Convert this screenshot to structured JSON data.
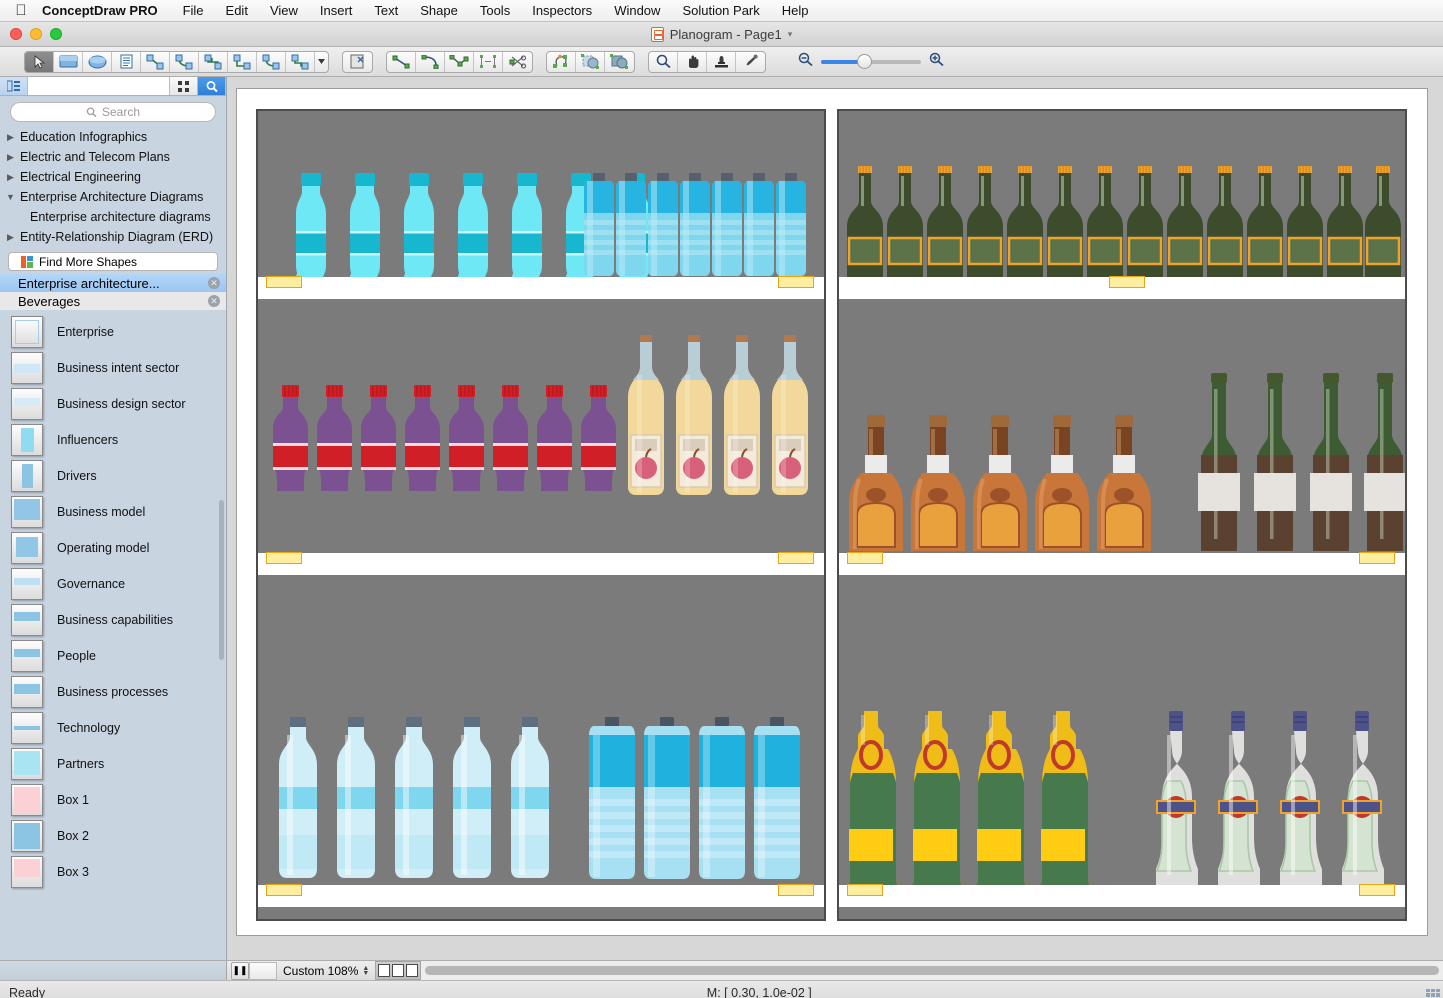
{
  "menubar": {
    "apple_icon": "apple-logo",
    "app_name": "ConceptDraw PRO",
    "items": [
      "File",
      "Edit",
      "View",
      "Insert",
      "Text",
      "Shape",
      "Tools",
      "Inspectors",
      "Window",
      "Solution Park",
      "Help"
    ]
  },
  "titlebar": {
    "document_title": "Planogram - Page1",
    "chevron": "⌄"
  },
  "toolbar": {
    "groups": [
      {
        "name": "selection-tools",
        "buttons": [
          {
            "name": "pointer-tool",
            "icon": "arrow-pointer-icon",
            "active": true
          },
          {
            "name": "rectangle-tool",
            "icon": "rectangle-icon",
            "active": false
          },
          {
            "name": "ellipse-tool",
            "icon": "ellipse-icon",
            "active": false
          },
          {
            "name": "text-tool",
            "icon": "text-block-icon",
            "active": false
          },
          {
            "name": "straight-connector-tool",
            "icon": "straight-connector-icon",
            "active": false
          },
          {
            "name": "curved-connector-tool",
            "icon": "curved-connector-icon",
            "active": false
          },
          {
            "name": "tree-connector-tool",
            "icon": "tree-connector-icon",
            "active": false
          },
          {
            "name": "right-angle-connector-tool",
            "icon": "right-angle-connector-icon",
            "active": false
          },
          {
            "name": "smart-connector-tool",
            "icon": "smart-connector-icon",
            "active": false
          },
          {
            "name": "multi-connector-tool",
            "icon": "multi-connector-icon",
            "active": false
          },
          {
            "name": "connector-dropdown",
            "icon": "caret-down-icon",
            "active": false
          }
        ]
      },
      {
        "name": "insert-image-group",
        "buttons": [
          {
            "name": "insert-image-tool",
            "icon": "image-insert-icon",
            "active": false
          }
        ]
      },
      {
        "name": "drawing-tools",
        "buttons": [
          {
            "name": "line-tool",
            "icon": "line-icon",
            "active": false
          },
          {
            "name": "arc-tool",
            "icon": "arc-icon",
            "active": false
          },
          {
            "name": "polyline-tool",
            "icon": "polyline-icon",
            "active": false
          },
          {
            "name": "distribute-tool",
            "icon": "distribute-icon",
            "active": false
          },
          {
            "name": "trim-tool",
            "icon": "scissors-icon",
            "active": false
          }
        ]
      },
      {
        "name": "shape-operations",
        "buttons": [
          {
            "name": "reshape-tool",
            "icon": "reshape-icon",
            "active": false
          },
          {
            "name": "subtract-shapes-tool",
            "icon": "subtract-shapes-icon",
            "active": false
          },
          {
            "name": "union-shapes-tool",
            "icon": "union-shapes-icon",
            "active": false
          }
        ]
      },
      {
        "name": "view-tools",
        "buttons": [
          {
            "name": "zoom-tool",
            "icon": "magnifier-icon",
            "active": false
          },
          {
            "name": "pan-tool",
            "icon": "hand-icon",
            "active": false
          },
          {
            "name": "stamp-tool",
            "icon": "stamp-icon",
            "active": false
          },
          {
            "name": "eyedropper-tool",
            "icon": "eyedropper-icon",
            "active": false
          }
        ]
      }
    ],
    "zoom_out_icon": "zoom-out-icon",
    "zoom_in_icon": "zoom-in-icon"
  },
  "sidebar": {
    "toolbar": {
      "tree-view-icon": "tree-view-icon",
      "grid-view-icon": "grid-view-icon",
      "search-icon": "search-icon"
    },
    "search_placeholder": "Search",
    "tree": [
      {
        "label": "Education Infographics",
        "expanded": false,
        "child": false
      },
      {
        "label": "Electric and Telecom Plans",
        "expanded": false,
        "child": false
      },
      {
        "label": "Electrical Engineering",
        "expanded": false,
        "child": false
      },
      {
        "label": "Enterprise Architecture Diagrams",
        "expanded": true,
        "child": false
      },
      {
        "label": "Enterprise architecture diagrams",
        "expanded": false,
        "child": true
      },
      {
        "label": "Entity-Relationship Diagram (ERD)",
        "expanded": false,
        "child": false
      }
    ],
    "find_more_shapes": "Find More Shapes",
    "stencils": [
      {
        "label": "Enterprise architecture...",
        "selected": true
      },
      {
        "label": "Beverages",
        "selected": false
      }
    ],
    "shapes": [
      {
        "label": "Enterprise",
        "swatch": "enterprise"
      },
      {
        "label": "Business intent sector",
        "swatch": "intent"
      },
      {
        "label": "Business design sector",
        "swatch": "design"
      },
      {
        "label": "Influencers",
        "swatch": "influencers"
      },
      {
        "label": "Drivers",
        "swatch": "drivers"
      },
      {
        "label": "Business model",
        "swatch": "model"
      },
      {
        "label": "Operating model",
        "swatch": "operating"
      },
      {
        "label": "Governance",
        "swatch": "governance"
      },
      {
        "label": "Business capabilities",
        "swatch": "capabilities"
      },
      {
        "label": "People",
        "swatch": "people"
      },
      {
        "label": "Business processes",
        "swatch": "processes"
      },
      {
        "label": "Technology",
        "swatch": "technology"
      },
      {
        "label": "Partners",
        "swatch": "partners"
      },
      {
        "label": "Box 1",
        "swatch": "box1"
      },
      {
        "label": "Box 2",
        "swatch": "box2"
      },
      {
        "label": "Box 3",
        "swatch": "box3"
      }
    ]
  },
  "statusbar": {
    "pause_icon": "pause-icon",
    "zoom_level": "Custom 108%",
    "stepper_icon": "stepper-updown-icon",
    "view_mode_icons": [
      "single-page-view-icon",
      "two-page-view-icon",
      "multi-page-view-icon"
    ],
    "ready_text": "Ready",
    "coordinates": "M: [ 0.30, 1.0e-02 ]"
  },
  "canvas": {
    "fixtures": [
      {
        "name": "left-cooler-fixture",
        "shelves": [
          {
            "name": "shelf-1",
            "products": [
              {
                "type": "soda-bottle-cyan",
                "count": 7,
                "tag": "price-tag"
              },
              {
                "type": "water-bottle-blue",
                "count": 7,
                "tag": "price-tag"
              }
            ]
          },
          {
            "name": "shelf-2",
            "products": [
              {
                "type": "cola-bottle-purple",
                "count": 8,
                "tag": "price-tag"
              },
              {
                "type": "apple-juice-bottle",
                "count": 4,
                "tag": "price-tag"
              }
            ]
          },
          {
            "name": "shelf-3",
            "products": [
              {
                "type": "mineral-water-bottle",
                "count": 5,
                "tag": "price-tag"
              },
              {
                "type": "large-water-bottle",
                "count": 4,
                "tag": "price-tag"
              }
            ]
          }
        ]
      },
      {
        "name": "right-cooler-fixture",
        "shelves": [
          {
            "name": "shelf-1",
            "products": [
              {
                "type": "beer-bottle-green",
                "count": 14,
                "tag": "price-tag"
              }
            ]
          },
          {
            "name": "shelf-2",
            "products": [
              {
                "type": "whiskey-bottle",
                "count": 5,
                "tag": "price-tag"
              },
              {
                "type": "wine-bottle",
                "count": 4,
                "tag": "price-tag"
              }
            ]
          },
          {
            "name": "shelf-3",
            "products": [
              {
                "type": "champagne-bottle",
                "count": 4,
                "tag": "price-tag"
              },
              {
                "type": "vodka-bottle",
                "count": 4,
                "tag": "price-tag"
              }
            ]
          }
        ]
      }
    ],
    "colors": {
      "fixture_bg": "#7b7b7b",
      "fixture_border": "#4b4b4b",
      "shelf": "#ffffff",
      "tag_fill": "#ffeea0",
      "tag_border": "#e8a317"
    }
  }
}
